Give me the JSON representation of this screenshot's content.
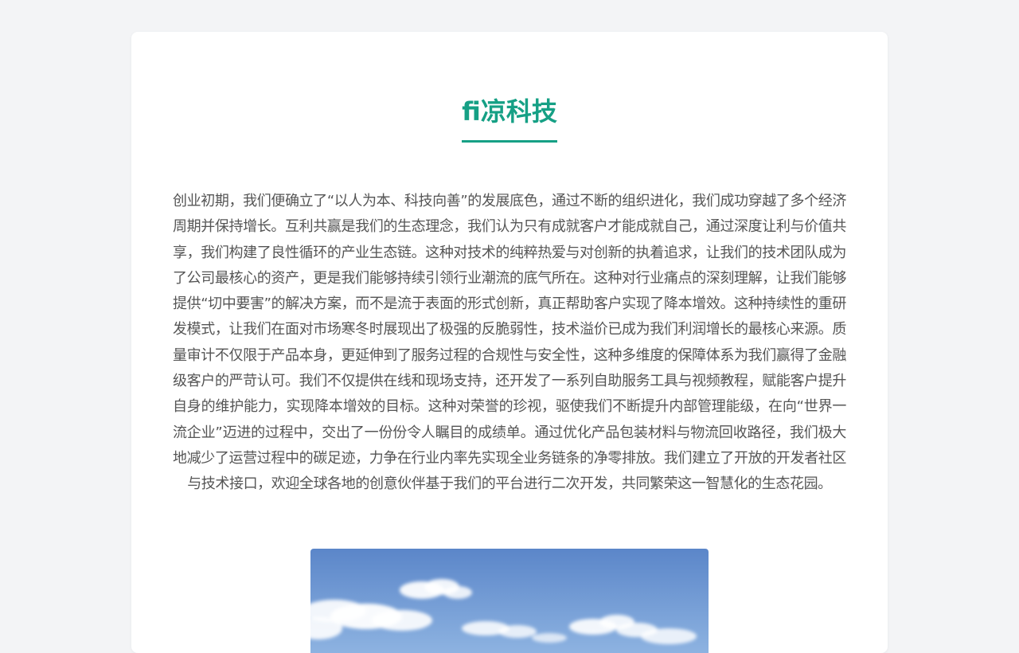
{
  "page": {
    "title": "fi凉科技",
    "body": "创业初期，我们便确立了“以人为本、科技向善”的发展底色，通过不断的组织进化，我们成功穿越了多个经济周期并保持增长。互利共赢是我们的生态理念，我们认为只有成就客户才能成就自己，通过深度让利与价值共享，我们构建了良性循环的产业生态链。这种对技术的纯粹热爱与对创新的执着追求，让我们的技术团队成为了公司最核心的资产，更是我们能够持续引领行业潮流的底气所在。这种对行业痛点的深刻理解，让我们能够提供“切中要害”的解决方案，而不是流于表面的形式创新，真正帮助客户实现了降本增效。这种持续性的重研发模式，让我们在面对市场寒冬时展现出了极强的反脆弱性，技术溢价已成为我们利润增长的最核心来源。质量审计不仅限于产品本身，更延伸到了服务过程的合规性与安全性，这种多维度的保障体系为我们赢得了金融级客户的严苛认可。我们不仅提供在线和现场支持，还开发了一系列自助服务工具与视频教程，赋能客户提升自身的维护能力，实现降本增效的目标。这种对荣誉的珍视，驱使我们不断提升内部管理能级，在向“世界一流企业”迈进的过程中，交出了一份份令人瞩目的成绩单。通过优化产品包装材料与物流回收路径，我们极大地减少了运营过程中的碳足迹，力争在行业内率先实现全业务链条的净零排放。我们建立了开放的开发者社区与技术接口，欢迎全球各地的创意伙伴基于我们的平台进行二次开发，共同繁荣这一智慧化的生态花园。"
  },
  "colors": {
    "accent": "#16a085",
    "page_background": "#f3f4f6",
    "card_background": "#ffffff",
    "text": "#555555",
    "sky_top": "#5b86c9",
    "sky_bottom": "#9cc0e8"
  },
  "image": {
    "subject": "blue sky with white clouds"
  }
}
